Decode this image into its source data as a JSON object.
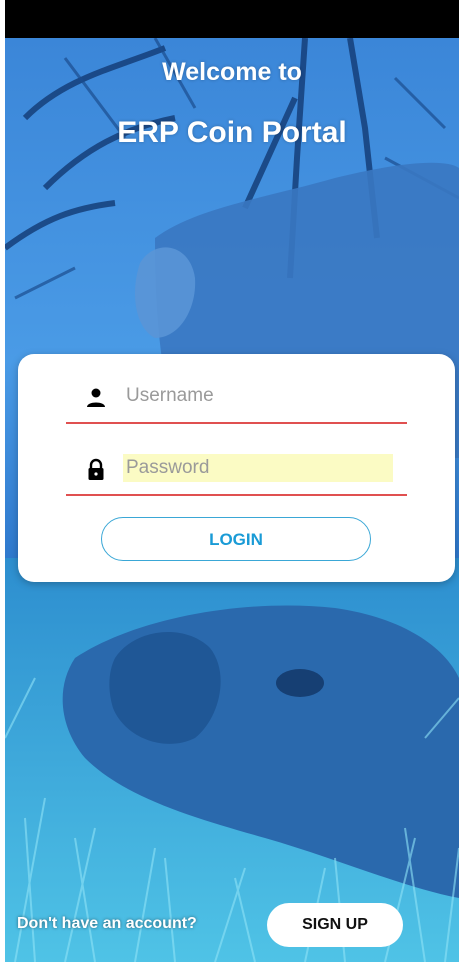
{
  "header": {
    "welcome_text": "Welcome to",
    "app_title": "ERP Coin Portal"
  },
  "login_form": {
    "username": {
      "placeholder": "Username",
      "value": "",
      "icon": "person-icon"
    },
    "password": {
      "placeholder": "Password",
      "value": "",
      "icon": "lock-icon"
    },
    "login_label": "LOGIN"
  },
  "footer": {
    "no_account_text": "Don't have an account?",
    "signup_label": "SIGN UP"
  },
  "colors": {
    "accent": "#1a9bd6",
    "field_underline": "#e05050",
    "autofill_highlight": "#fbfbc4"
  }
}
